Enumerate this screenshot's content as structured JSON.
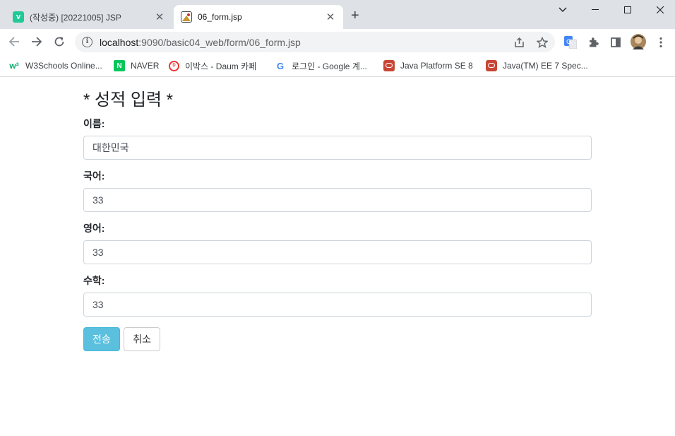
{
  "browser": {
    "tabs": [
      {
        "title": "(작성중) [20221005] JSP",
        "favicon": "v-logo-icon",
        "active": false
      },
      {
        "title": "06_form.jsp",
        "favicon": "image-icon",
        "active": true
      }
    ],
    "url_host": "localhost",
    "url_rest": ":9090/basic04_web/form/06_form.jsp",
    "bookmarks": [
      {
        "label": "W3Schools Online...",
        "icon": "w3schools-icon"
      },
      {
        "label": "NAVER",
        "icon": "naver-icon"
      },
      {
        "label": "이박스 - Daum 카페",
        "icon": "daum-icon"
      },
      {
        "label": "로그인 - Google 계...",
        "icon": "google-icon"
      },
      {
        "label": "Java Platform SE 8",
        "icon": "oracle-icon"
      },
      {
        "label": "Java(TM) EE 7 Spec...",
        "icon": "oracle-icon"
      }
    ]
  },
  "page": {
    "title": "* 성적 입력 *",
    "fields": [
      {
        "label": "이름:",
        "value": "대한민국"
      },
      {
        "label": "국어:",
        "value": "33"
      },
      {
        "label": "영어:",
        "value": "33"
      },
      {
        "label": "수학:",
        "value": "33"
      }
    ],
    "submit_label": "전송",
    "cancel_label": "취소"
  },
  "colors": {
    "submit_bg": "#5bc0de",
    "tabstrip_bg": "#dee1e6"
  }
}
